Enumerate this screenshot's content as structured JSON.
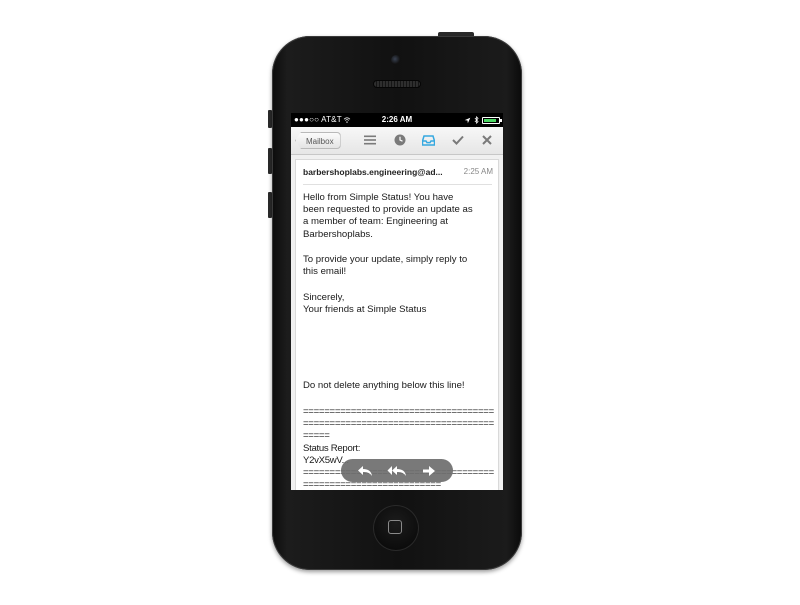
{
  "status_bar": {
    "carrier": "●●●○○ AT&T",
    "time": "2:26 AM",
    "battery_level": 0.85,
    "icons": [
      "wifi-icon",
      "location-icon",
      "bluetooth-icon",
      "battery-icon"
    ]
  },
  "toolbar": {
    "back_label": "Mailbox",
    "icons": [
      "list-icon",
      "clock-icon",
      "inbox-tray-icon",
      "checkmark-icon",
      "close-icon"
    ],
    "accent_color": "#35a8e0"
  },
  "email": {
    "sender": "barbershoplabs.engineering@ad...",
    "time": "2:25 AM",
    "paragraph_1": "Hello from Simple Status! You have been requested to provide an update as a member of team: Engineering at Barbershoplabs.",
    "paragraph_2": "To provide your update, simply reply to this email!",
    "signoff_1": "Sincerely,",
    "signoff_2": "Your friends at Simple Status",
    "notice": "Do not delete anything below this line!",
    "separator_block": "=============================================================================",
    "status_report_label": "Status Report:",
    "status_report_code": "Y2vX5wV...",
    "separator_block_2": "=============================================================="
  },
  "action_pill": {
    "icons": [
      "reply-icon",
      "reply-all-icon",
      "forward-icon"
    ]
  }
}
